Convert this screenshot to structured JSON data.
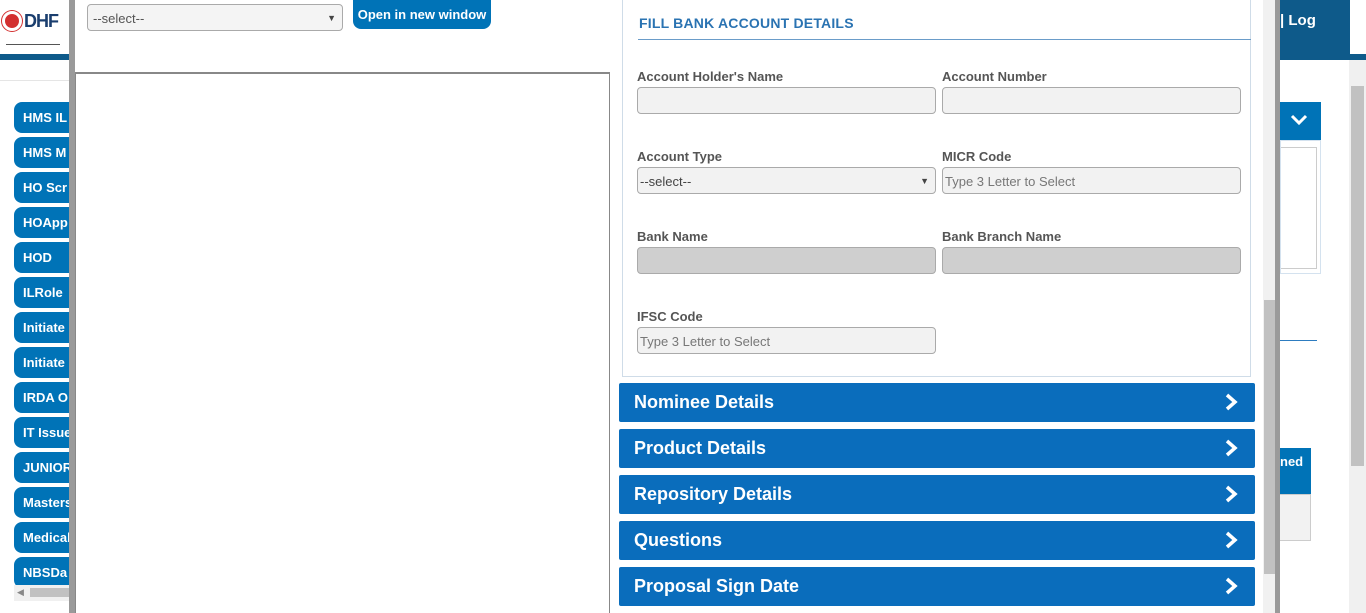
{
  "background": {
    "logo_text": "DHF",
    "log_link": "| Log",
    "menu_items": [
      "HMS IL",
      "HMS M",
      "HO Scr",
      "HOApp",
      "HOD",
      "ILRole",
      "Initiate",
      "Initiate",
      "IRDA O",
      "IT Issue",
      "JUNIOR",
      "Masters",
      "Medical",
      "NBSDa"
    ],
    "right_tab_label": "ned"
  },
  "viewer": {
    "doc_select_value": "--select--",
    "open_button": "Open in new window"
  },
  "bank": {
    "section_title": "FILL BANK ACCOUNT DETAILS",
    "holder_label": "Account Holder's Name",
    "holder_value": "",
    "number_label": "Account Number",
    "number_value": "",
    "type_label": "Account Type",
    "type_value": "--select--",
    "micr_label": "MICR Code",
    "micr_placeholder": "Type 3 Letter to Select",
    "bank_name_label": "Bank Name",
    "branch_label": "Bank Branch Name",
    "ifsc_label": "IFSC Code",
    "ifsc_placeholder": "Type 3 Letter to Select"
  },
  "accordions": [
    "Nominee Details",
    "Product Details",
    "Repository Details",
    "Questions",
    "Proposal Sign Date"
  ],
  "colors": {
    "primary": "#0a6dbc",
    "section_title": "#2a73b2",
    "header_dark": "#0e5a8a"
  }
}
